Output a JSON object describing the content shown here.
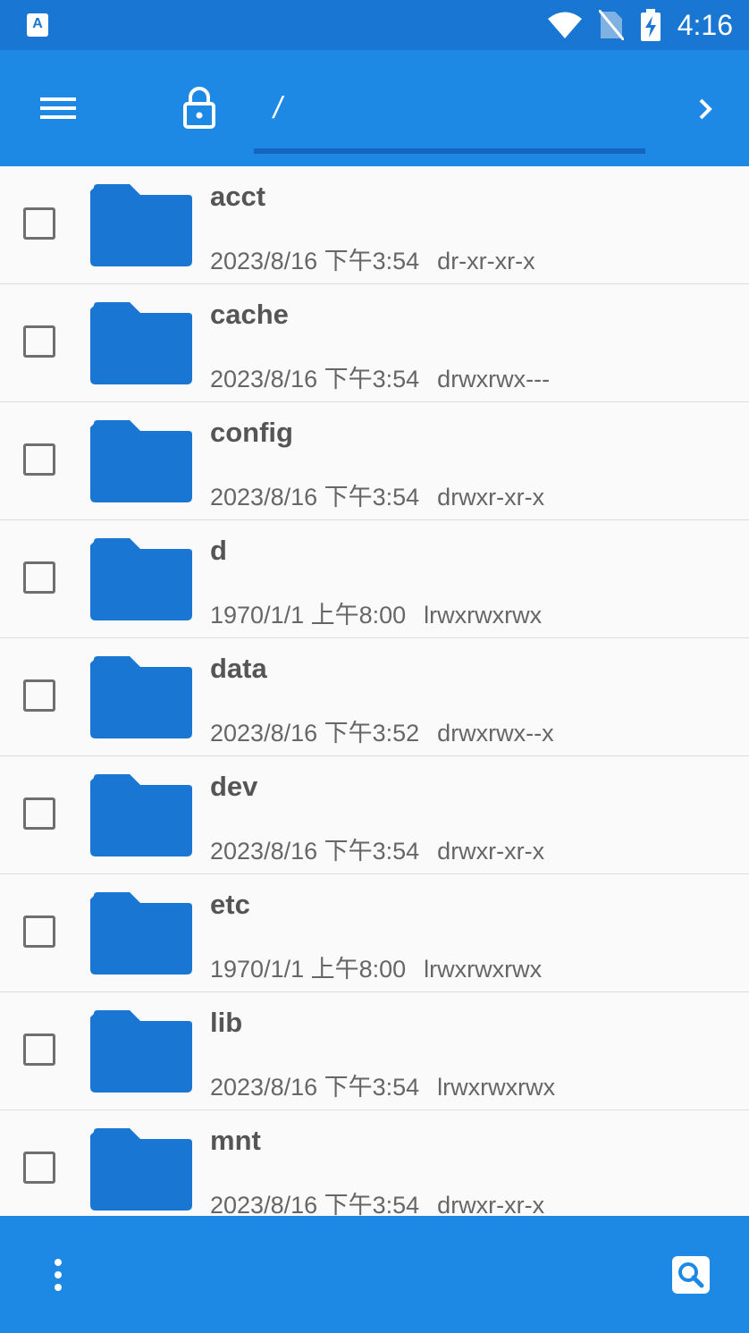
{
  "status_bar": {
    "time": "4:16",
    "app_icon_letter": "A"
  },
  "toolbar": {
    "path": "/"
  },
  "colors": {
    "primary_dark": "#1976d2",
    "primary": "#1e88e5",
    "folder": "#1976d2",
    "underline": "#1565c0"
  },
  "files": [
    {
      "name": "acct",
      "date": "2023/8/16 下午3:54",
      "perm": "dr-xr-xr-x"
    },
    {
      "name": "cache",
      "date": "2023/8/16 下午3:54",
      "perm": "drwxrwx---"
    },
    {
      "name": "config",
      "date": "2023/8/16 下午3:54",
      "perm": "drwxr-xr-x"
    },
    {
      "name": "d",
      "date": "1970/1/1 上午8:00",
      "perm": "lrwxrwxrwx"
    },
    {
      "name": "data",
      "date": "2023/8/16 下午3:52",
      "perm": "drwxrwx--x"
    },
    {
      "name": "dev",
      "date": "2023/8/16 下午3:54",
      "perm": "drwxr-xr-x"
    },
    {
      "name": "etc",
      "date": "1970/1/1 上午8:00",
      "perm": "lrwxrwxrwx"
    },
    {
      "name": "lib",
      "date": "2023/8/16 下午3:54",
      "perm": "lrwxrwxrwx"
    },
    {
      "name": "mnt",
      "date": "2023/8/16 下午3:54",
      "perm": "drwxr-xr-x"
    }
  ]
}
